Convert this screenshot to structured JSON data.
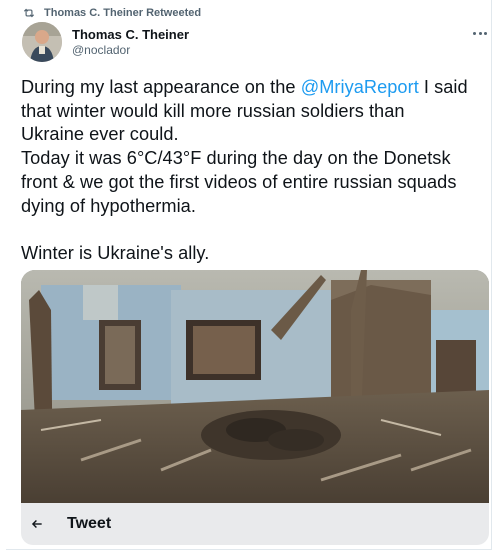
{
  "retweet": {
    "icon": "retweet-icon",
    "text": "Thomas C. Theiner Retweeted"
  },
  "author": {
    "name": "Thomas C. Theiner",
    "handle": "@noclador",
    "avatar_icon": "avatar"
  },
  "more_icon": "more-options-icon",
  "tweet": {
    "lines": [
      [
        "During my last appearance on the ",
        "@MriyaReport",
        " I said"
      ],
      "that winter would kill more russian soldiers than",
      "Ukraine ever could.",
      "Today it was 6°C/43°F during the day on the Donetsk",
      "front & we got the first videos of entire russian squads",
      "dying of hypothermia.",
      "",
      "Winter is Ukraine's ally."
    ]
  },
  "media": {
    "description_icon": "war-video-thumbnail"
  },
  "bottom_bar": {
    "back_icon": "back-arrow-icon",
    "title": "Tweet"
  },
  "colors": {
    "accent": "#1d9bf0",
    "text": "#0f1419",
    "muted": "#536471",
    "bar_bg": "#e9eaec"
  }
}
